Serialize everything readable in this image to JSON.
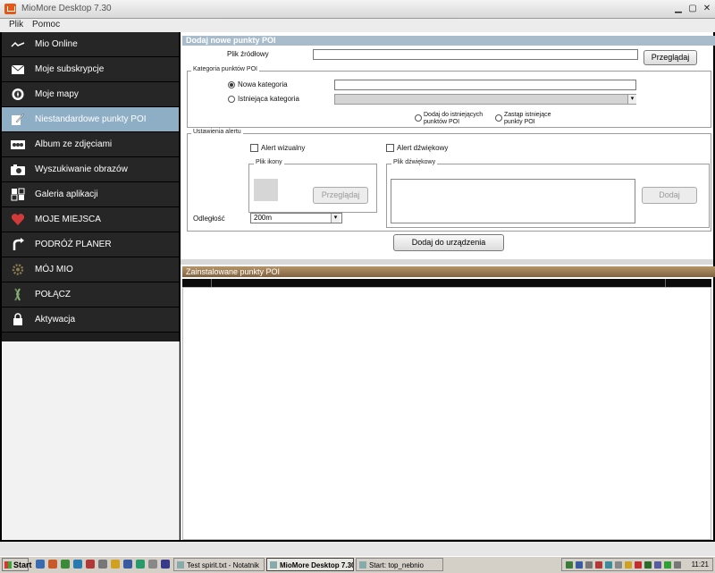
{
  "window": {
    "title": "MioMore Desktop 7.30"
  },
  "menu": [
    "Plik",
    "Pomoc"
  ],
  "sidebar": {
    "items": [
      {
        "label": "Mio Online",
        "icon": "signal-wave-icon"
      },
      {
        "label": "Moje subskrypcje",
        "icon": "envelope-icon"
      },
      {
        "label": "Moje mapy",
        "icon": "compass-icon"
      },
      {
        "label": "Niestandardowe punkty POI",
        "icon": "poi-pencil-icon",
        "active": true
      },
      {
        "label": "Album ze zdjęciami",
        "icon": "photo-album-icon"
      },
      {
        "label": "Wyszukiwanie obrazów",
        "icon": "camera-icon"
      },
      {
        "label": "Galeria aplikacji",
        "icon": "apps-grid-icon"
      },
      {
        "label": "MOJE MIEJSCA",
        "icon": "heart-icon"
      },
      {
        "label": "PODRÓŻ PLANER",
        "icon": "route-icon"
      },
      {
        "label": "MÓJ MIO",
        "icon": "gear-icon"
      },
      {
        "label": "POŁĄCZ",
        "icon": "connect-icon"
      },
      {
        "label": "Aktywacja",
        "icon": "lock-icon"
      }
    ]
  },
  "add_poi": {
    "header": "Dodaj nowe punkty POI",
    "source_label": "Plik źródłowy",
    "source_value": "",
    "browse": "Przeglądaj",
    "category_legend": "Kategoria punktów POI",
    "new_category": "Nowa kategoria",
    "existing_category": "Istniejąca kategoria",
    "add_to_existing": "Dodaj do istniejących punktów POI",
    "replace_existing": "Zastąp istniejące punkty POI",
    "alert_legend": "Ustawienia alertu",
    "visual_alert": "Alert wizualny",
    "sound_alert": "Alert dźwiękowy",
    "icon_file_legend": "Plik ikony",
    "icon_browse": "Przeglądaj",
    "sound_file_legend": "Plik dźwiękowy",
    "sound_add": "Dodaj",
    "distance_label": "Odległość",
    "distance_value": "200m",
    "add_to_device": "Dodaj do urządzenia"
  },
  "installed_poi": {
    "header": "Zainstalowane punkty POI"
  },
  "taskbar": {
    "start": "Start",
    "tasks": [
      "Test spirit.txt - Notatnik",
      "MioMore Desktop 7.30",
      "Start: top_nebnio"
    ],
    "clock": "11:21"
  },
  "colors": {
    "sidebar_bg": "#262626",
    "active_item": "#8eaec6",
    "panel_header": "#a8bccc",
    "installed_header": "#8b6d48"
  }
}
